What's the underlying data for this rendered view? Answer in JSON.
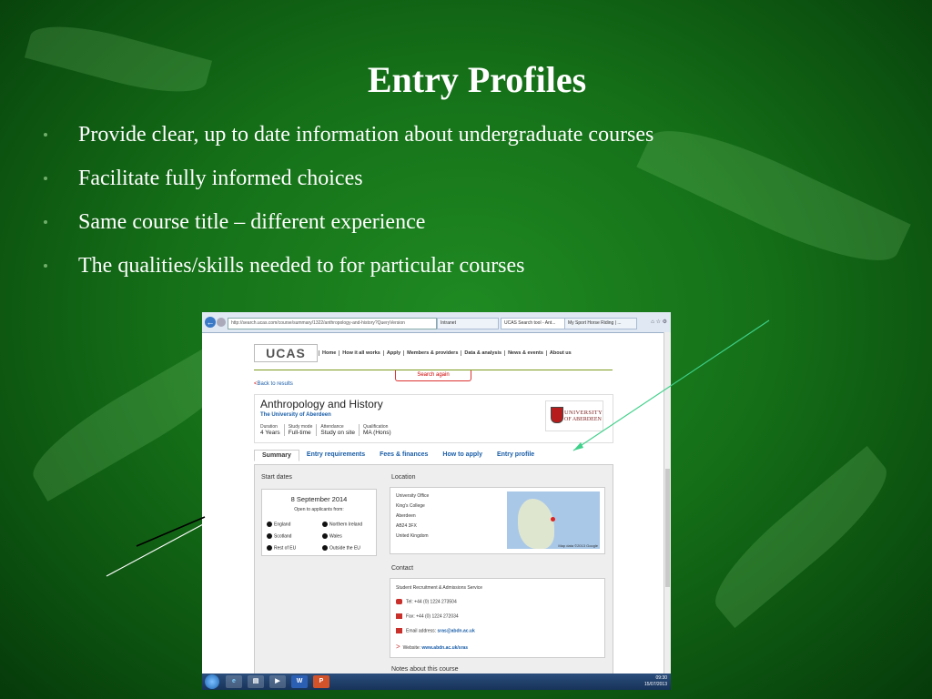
{
  "slide": {
    "title": "Entry Profiles",
    "bullets": [
      "Provide clear, up to date information about undergraduate courses",
      "Facilitate fully informed choices",
      "Same course title – different experience",
      "The qualities/skills needed to for particular courses"
    ]
  },
  "browser": {
    "address": "http://search.ucas.com/course/summary/1322/anthropology-and-history?QueryVersion",
    "tabs": [
      "Intranet",
      "UCAS Search tool - Ant...",
      "My Sport Horse Riding | ..."
    ]
  },
  "ucas": {
    "logo": "UCAS",
    "nav": [
      "Home",
      "How it all works",
      "Apply",
      "Members & providers",
      "Data & analysis",
      "News & events",
      "About us"
    ],
    "search_again": "Search again",
    "back_link": "Back to results",
    "course": {
      "title": "Anthropology and History",
      "university": "The University of Aberdeen",
      "facts": [
        {
          "label": "Duration",
          "value": "4 Years"
        },
        {
          "label": "Study mode",
          "value": "Full-time"
        },
        {
          "label": "Attendance",
          "value": "Study on site"
        },
        {
          "label": "Qualification",
          "value": "MA (Hons)"
        }
      ],
      "logo_line1": "UNIVERSITY",
      "logo_line2": "OF ABERDEEN"
    },
    "tabs": [
      "Summary",
      "Entry requirements",
      "Fees & finances",
      "How to apply",
      "Entry profile"
    ],
    "start_dates": {
      "heading": "Start dates",
      "date": "8 September 2014",
      "open_to": "Open to applicants from:",
      "regions": [
        "England",
        "Northern Ireland",
        "Scotland",
        "Wales",
        "Rest of EU",
        "Outside the EU"
      ]
    },
    "location": {
      "heading": "Location",
      "address": [
        "University Office",
        "King's College",
        "Aberdeen",
        "AB24 3FX",
        "United Kingdom"
      ],
      "map_caption": "Map data ©2013 Google"
    },
    "contact": {
      "heading": "Contact",
      "service": "Student Recruitment & Admissions Service",
      "tel": "Tel: +44 (0) 1224 273504",
      "fax": "Fax: +44 (0) 1224 272034",
      "email_label": "Email address: ",
      "email": "sras@abdn.ac.uk",
      "website_label": "Website: ",
      "website": "www.abdn.ac.uk/sras"
    },
    "notes_heading": "Notes about this course"
  },
  "taskbar": {
    "time": "09:30",
    "date": "15/07/2013"
  },
  "colors": {
    "accent_link": "#1a5ea8",
    "arrow": "#3fd08a"
  }
}
